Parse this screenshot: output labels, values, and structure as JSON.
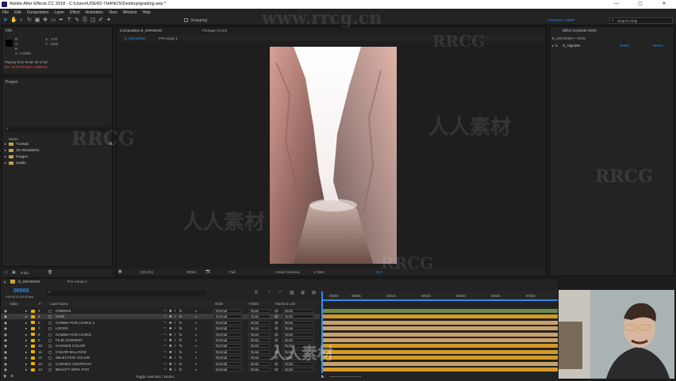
{
  "window": {
    "title": "Adobe After Effects CC 2018 - C:\\Users\\USER2-THANOS\\Desktop\\grading.aep *",
    "min": "—",
    "max": "▢",
    "close": "✕"
  },
  "menu": [
    "File",
    "Edit",
    "Composition",
    "Layer",
    "Effect",
    "Animation",
    "View",
    "Window",
    "Help"
  ],
  "toolbar": {
    "snapping": "Snapping",
    "workspace": "THANOS COMP",
    "search_placeholder": "Search Help"
  },
  "info": {
    "title": "Info",
    "r": "R :",
    "g": "G :",
    "b": "B :",
    "a": "A : 0.0000",
    "x": "X : -270",
    "y": "Y : 1019",
    "playing": "Playing from RAM: 50 of 50",
    "fps": "fps: 26.67/25 (607 realtime)"
  },
  "project": {
    "title": "Project",
    "name_col": "Name",
    "folders": [
      "*Comps",
      "3D RENDERS",
      "Images",
      "Solids"
    ],
    "bpc": "8 bpc"
  },
  "comp_panel": {
    "tab": "Composition 8_GRADING",
    "footage": "Footage (none)",
    "crumb1": "8_GRADING",
    "crumb2": "Pre-comp 1",
    "zoom": "(33.3%)",
    "timecode": "00041",
    "res": "Full",
    "camera": "Active Camera",
    "views": "1 View",
    "offset": "+0.0"
  },
  "effect_controls": {
    "tab": "Effect Controls VIGN",
    "layer": "8_GRADING • VIGN",
    "fx_name": "S_Vignette",
    "reset": "Reset",
    "about": "About..."
  },
  "timeline": {
    "tab": "8_GRADING",
    "tab2": "Pre-comp 1",
    "timecode": "00000",
    "fps_note": "0:00:00:00 (25.00 fps)",
    "headers": {
      "video": "Video",
      "num": "#",
      "layer_name": "Layer Name",
      "mode": "Mode",
      "trkmat": "TrkMat",
      "parent": "Parent & Link"
    },
    "ruler": [
      "00000",
      "00005",
      "00010",
      "00015",
      "00020",
      "00025",
      "00030"
    ],
    "layers": [
      {
        "num": "4",
        "name": "GREENS",
        "mode": "Normal",
        "trk": "None",
        "parent": "None"
      },
      {
        "num": "5",
        "name": "VIGN",
        "mode": "Normal",
        "trk": "None",
        "parent": "None"
      },
      {
        "num": "6",
        "name": "GAMMA FOR LOOKS 2",
        "mode": "Normal",
        "trk": "None",
        "parent": "None"
      },
      {
        "num": "7",
        "name": "LOOKS",
        "mode": "Normal",
        "trk": "None",
        "parent": "None"
      },
      {
        "num": "8",
        "name": "GAMMA FOR LOOKS",
        "mode": "Normal",
        "trk": "None",
        "parent": "None"
      },
      {
        "num": "9",
        "name": "FILM CONVERT",
        "mode": "Normal",
        "trk": "None",
        "parent": "None"
      },
      {
        "num": "10",
        "name": "CHANGE COLOR",
        "mode": "Normal",
        "trk": "None",
        "parent": "None"
      },
      {
        "num": "11",
        "name": "COLOR BALANCE",
        "mode": "Normal",
        "trk": "None",
        "parent": "None"
      },
      {
        "num": "12",
        "name": "SELECTIVE COLOR",
        "mode": "Normal",
        "trk": "None",
        "parent": "None"
      },
      {
        "num": "13",
        "name": "CURVES CONTRAST",
        "mode": "Normal",
        "trk": "None",
        "parent": "None"
      },
      {
        "num": "14",
        "name": "BEAUTY WITH FOG",
        "mode": "Normal",
        "trk": "None",
        "parent": "None"
      }
    ],
    "footer": "Toggle Switches / Modes"
  },
  "watermark": {
    "url": "www.rrcg.cn",
    "brand": "RRCG",
    "cn": "人人素材"
  },
  "colors": {
    "accent": "#2d8ceb",
    "label_yellow": "#f0b000",
    "bar_tan": "#c9a26a",
    "bar_gold": "#d39a2a",
    "bar_olive": "#6d8a4a"
  }
}
